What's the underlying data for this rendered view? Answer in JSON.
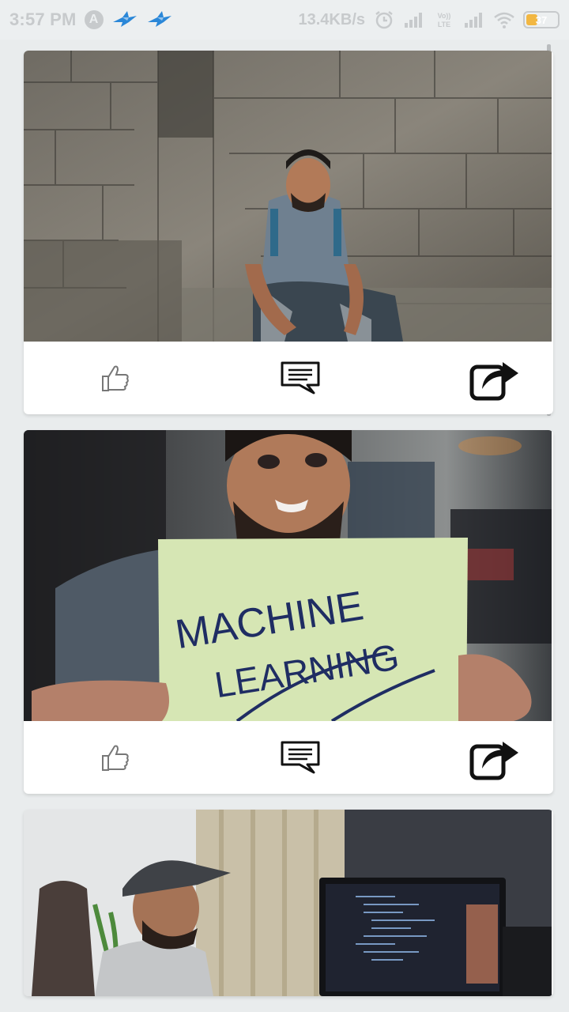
{
  "status_bar": {
    "time": "3:57 PM",
    "app_badge": "A",
    "net_speed": "13.4KB/s",
    "volte": "Vo)) LTE",
    "battery": "37",
    "battery_level": 0.37,
    "icons": [
      "app-a-icon",
      "bird-icon",
      "bird-icon",
      "alarm-icon",
      "signal-icon",
      "volte-icon",
      "signal-icon",
      "wifi-icon",
      "battery-icon"
    ]
  },
  "feed": {
    "posts": [
      {
        "image": "man-sitting-at-temple-ruins",
        "actions": [
          "like-icon",
          "comment-icon",
          "share-icon"
        ]
      },
      {
        "image": "man-holding-machine-learning-sign",
        "sign_text": [
          "MACHINE",
          "LEARNING"
        ],
        "actions": [
          "like-icon",
          "comment-icon",
          "share-icon"
        ]
      },
      {
        "image": "man-in-cap-at-computer-desk",
        "actions": []
      }
    ]
  },
  "colors": {
    "background": "#e9eced",
    "card": "#ffffff",
    "battery_fill": "#f2b742"
  }
}
